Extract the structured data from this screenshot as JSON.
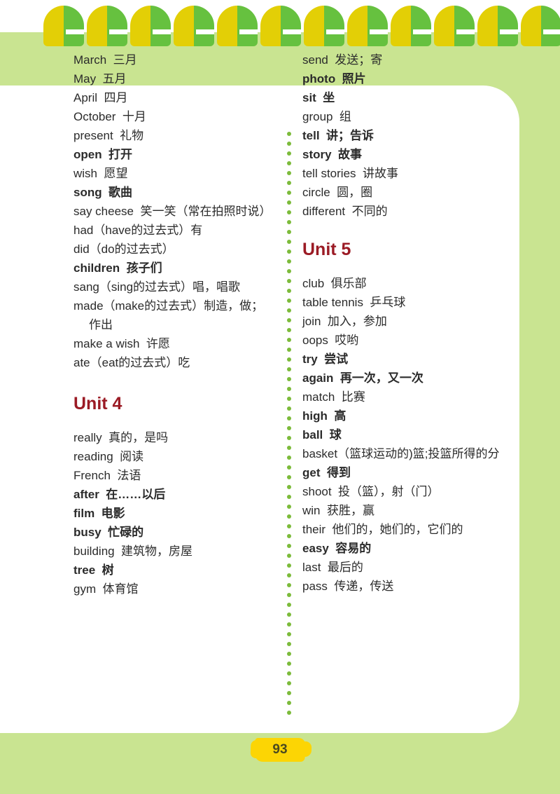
{
  "page": {
    "number": "93",
    "background_color": "#c9e491",
    "card_color": "#ffffff",
    "heading_color": "#9b1b25",
    "dot_color": "#7cbb3a",
    "badge_color": "#fcd504"
  },
  "binding": {
    "ring_count": 12,
    "ring_left_color": "#e3cf06",
    "ring_right_color": "#66c13f"
  },
  "columns": {
    "left": [
      {
        "type": "entry",
        "bold": false,
        "text": "March  三月"
      },
      {
        "type": "entry",
        "bold": false,
        "text": "May  五月"
      },
      {
        "type": "entry",
        "bold": false,
        "text": "April  四月"
      },
      {
        "type": "entry",
        "bold": false,
        "text": "October  十月"
      },
      {
        "type": "entry",
        "bold": false,
        "text": "present  礼物"
      },
      {
        "type": "entry",
        "bold": true,
        "text": "open  打开"
      },
      {
        "type": "entry",
        "bold": false,
        "text": "wish  愿望"
      },
      {
        "type": "entry",
        "bold": true,
        "text": "song  歌曲"
      },
      {
        "type": "entry",
        "bold": false,
        "text": "say cheese  笑一笑（常在拍照时说）"
      },
      {
        "type": "entry",
        "bold": false,
        "text": "had（have的过去式）有"
      },
      {
        "type": "entry",
        "bold": false,
        "text": "did（do的过去式）"
      },
      {
        "type": "entry",
        "bold": true,
        "text": "children  孩子们"
      },
      {
        "type": "entry",
        "bold": false,
        "text": "sang（sing的过去式）唱，唱歌"
      },
      {
        "type": "entry",
        "bold": false,
        "text": "made（make的过去式）制造，做；"
      },
      {
        "type": "continuation",
        "bold": false,
        "text": "作出"
      },
      {
        "type": "entry",
        "bold": false,
        "text": "make a wish  许愿"
      },
      {
        "type": "entry",
        "bold": false,
        "text": "ate（eat的过去式）吃"
      },
      {
        "type": "heading",
        "text": "Unit 4"
      },
      {
        "type": "entry",
        "bold": false,
        "text": "really  真的，是吗"
      },
      {
        "type": "entry",
        "bold": false,
        "text": "reading  阅读"
      },
      {
        "type": "entry",
        "bold": false,
        "text": "French  法语"
      },
      {
        "type": "entry",
        "bold": true,
        "text": "after  在……以后"
      },
      {
        "type": "entry",
        "bold": true,
        "text": "film  电影"
      },
      {
        "type": "entry",
        "bold": true,
        "text": "busy  忙碌的"
      },
      {
        "type": "entry",
        "bold": false,
        "text": "building  建筑物，房屋"
      },
      {
        "type": "entry",
        "bold": true,
        "text": "tree  树"
      },
      {
        "type": "entry",
        "bold": false,
        "text": "gym  体育馆"
      }
    ],
    "right": [
      {
        "type": "entry",
        "bold": false,
        "text": "send  发送；寄"
      },
      {
        "type": "entry",
        "bold": true,
        "text": "photo  照片"
      },
      {
        "type": "entry",
        "bold": true,
        "text": "sit  坐"
      },
      {
        "type": "entry",
        "bold": false,
        "text": "group  组"
      },
      {
        "type": "entry",
        "bold": true,
        "text": "tell  讲；告诉"
      },
      {
        "type": "entry",
        "bold": true,
        "text": "story  故事"
      },
      {
        "type": "entry",
        "bold": false,
        "text": "tell stories  讲故事"
      },
      {
        "type": "entry",
        "bold": false,
        "text": "circle  圆，圈"
      },
      {
        "type": "entry",
        "bold": false,
        "text": "different  不同的"
      },
      {
        "type": "heading",
        "text": "Unit 5"
      },
      {
        "type": "entry",
        "bold": false,
        "text": "club  俱乐部"
      },
      {
        "type": "entry",
        "bold": false,
        "text": "table tennis  乒乓球"
      },
      {
        "type": "entry",
        "bold": false,
        "text": "join  加入，参加"
      },
      {
        "type": "entry",
        "bold": false,
        "text": "oops  哎哟"
      },
      {
        "type": "entry",
        "bold": true,
        "text": "try  尝试"
      },
      {
        "type": "entry",
        "bold": true,
        "text": "again  再一次，又一次"
      },
      {
        "type": "entry",
        "bold": false,
        "text": "match  比赛"
      },
      {
        "type": "entry",
        "bold": true,
        "text": "high  高"
      },
      {
        "type": "entry",
        "bold": true,
        "text": "ball  球"
      },
      {
        "type": "entry",
        "bold": false,
        "text": "basket（篮球运动的)篮;投篮所得的分"
      },
      {
        "type": "entry",
        "bold": true,
        "text": "get  得到"
      },
      {
        "type": "entry",
        "bold": false,
        "text": "shoot  投（篮），射（门）"
      },
      {
        "type": "entry",
        "bold": false,
        "text": "win  获胜，赢"
      },
      {
        "type": "entry",
        "bold": false,
        "text": "their  他们的，她们的，它们的"
      },
      {
        "type": "entry",
        "bold": true,
        "text": "easy  容易的"
      },
      {
        "type": "entry",
        "bold": false,
        "text": "last  最后的"
      },
      {
        "type": "entry",
        "bold": false,
        "text": "pass  传递，传送"
      }
    ]
  }
}
